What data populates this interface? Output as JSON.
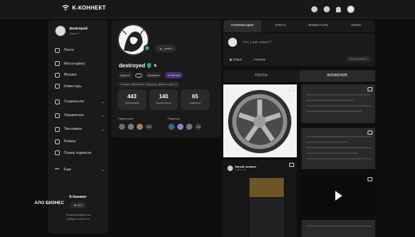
{
  "topbar": {
    "brand": "K-КОННЕКТ"
  },
  "sidebar": {
    "user": {
      "name": "destroyed",
      "handle": "@qsoul"
    },
    "menu": [
      {
        "label": "Лента",
        "icon": "home-icon",
        "expandable": false
      },
      {
        "label": "Мессенджер",
        "icon": "chat-icon",
        "expandable": false
      },
      {
        "label": "Музыка",
        "icon": "music-icon",
        "expandable": false
      },
      {
        "label": "Инвентарь",
        "icon": "inventory-icon",
        "expandable": false
      },
      {
        "label": "Социальное",
        "icon": "people-icon",
        "expandable": true
      },
      {
        "label": "Управление",
        "icon": "settings-icon",
        "expandable": true
      },
      {
        "label": "Экономика",
        "icon": "coins-icon",
        "expandable": true
      },
      {
        "label": "Кликер",
        "icon": "cursor-icon",
        "expandable": false
      },
      {
        "label": "Планы подписок",
        "icon": "star-icon",
        "expandable": false
      },
      {
        "label": "Еще",
        "icon": "more-icon",
        "expandable": true
      }
    ],
    "footer": {
      "brand": "K-Коннект",
      "version": "v2.9",
      "legal_1": "Правообладателям",
      "legal_2": "verif@k-connect.ru"
    }
  },
  "profile": {
    "status_chip": "Iseebl",
    "name": "destroyed",
    "tags": {
      "handle": "@qsoul",
      "handle2": "@ryalinko",
      "plan": "Ultimate"
    },
    "also_known": "А также: @econnect, @kyacop, @wnk и ещё 13",
    "stats": [
      {
        "value": "443",
        "label": "публикаций"
      },
      {
        "value": "140",
        "label": "подписчиков"
      },
      {
        "value": "65",
        "label": "подписок"
      }
    ],
    "followers_label": "Подписчики",
    "followers_more": "+137",
    "following_label": "Подписки",
    "following_more": "+62"
  },
  "feed": {
    "tabs": [
      "ПУБЛИКАЦИИ",
      "СТЕНА",
      "ИНВЕНТАРЬ",
      "ИНФО"
    ],
    "composer": {
      "placeholder": "Что у вас нового?",
      "media": "Медиа",
      "music": "Музыка",
      "publish": "Опубликовать"
    },
    "subtabs": [
      "ПОСТЫ",
      "ВЛОЖЕНИЯ"
    ],
    "post2": {
      "author": "Умный человек",
      "time": "только что",
      "caption": "АЛО БИЗНЕС"
    }
  },
  "colors": {
    "accent": "#7c5cd6",
    "verified": "#2fa657",
    "ultimate": "#4b2f7a"
  }
}
